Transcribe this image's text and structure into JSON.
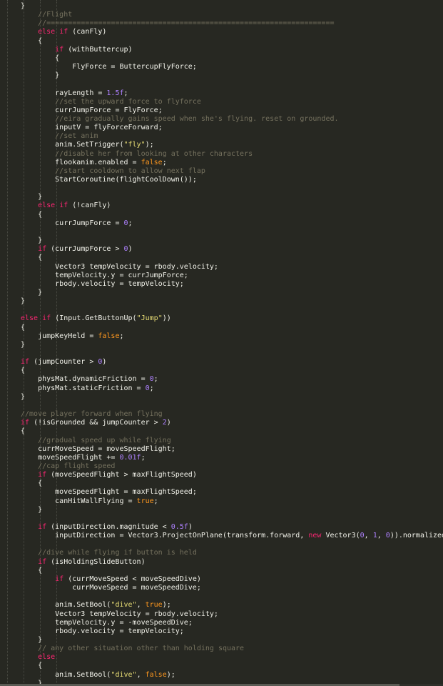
{
  "editor": {
    "language": "C#",
    "theme_colors": {
      "background": "#272822",
      "keyword": "#f92672",
      "comment": "#75715e",
      "string": "#e6db74",
      "number": "#ae81ff",
      "boolean": "#fd971f",
      "text": "#e8e8e2"
    },
    "lines": [
      {
        "col": 0,
        "tokens": [
          [
            "t",
            "}"
          ]
        ]
      },
      {
        "col": 4,
        "tokens": [
          [
            "c",
            "//Flight"
          ]
        ]
      },
      {
        "col": 4,
        "tokens": [
          [
            "c",
            "//==================================================================="
          ]
        ]
      },
      {
        "col": 4,
        "tokens": [
          [
            "k",
            "else"
          ],
          [
            "t",
            " "
          ],
          [
            "k",
            "if"
          ],
          [
            "t",
            " (canFly)"
          ]
        ]
      },
      {
        "col": 4,
        "tokens": [
          [
            "t",
            "{"
          ]
        ]
      },
      {
        "col": 8,
        "tokens": [
          [
            "k",
            "if"
          ],
          [
            "t",
            " (withButtercup)"
          ]
        ]
      },
      {
        "col": 8,
        "tokens": [
          [
            "t",
            "{"
          ]
        ]
      },
      {
        "col": 12,
        "tokens": [
          [
            "t",
            "FlyForce = ButtercupFlyForce;"
          ]
        ]
      },
      {
        "col": 8,
        "tokens": [
          [
            "t",
            "}"
          ]
        ]
      },
      {
        "col": 0,
        "tokens": []
      },
      {
        "col": 8,
        "tokens": [
          [
            "t",
            "rayLength = "
          ],
          [
            "n",
            "1.5f"
          ],
          [
            "t",
            ";"
          ]
        ]
      },
      {
        "col": 8,
        "tokens": [
          [
            "c",
            "//set the upward force to flyforce"
          ]
        ]
      },
      {
        "col": 8,
        "tokens": [
          [
            "t",
            "currJumpForce = FlyForce;"
          ]
        ]
      },
      {
        "col": 8,
        "tokens": [
          [
            "c",
            "//eira gradually gains speed when she's flying. reset on grounded."
          ]
        ]
      },
      {
        "col": 8,
        "tokens": [
          [
            "t",
            "inputV = flyForceForward;"
          ]
        ]
      },
      {
        "col": 8,
        "tokens": [
          [
            "c",
            "//set anim"
          ]
        ]
      },
      {
        "col": 8,
        "tokens": [
          [
            "t",
            "anim.SetTrigger("
          ],
          [
            "s",
            "\"fly\""
          ],
          [
            "t",
            ");"
          ]
        ]
      },
      {
        "col": 8,
        "tokens": [
          [
            "c",
            "//disable her from looking at other characters"
          ]
        ]
      },
      {
        "col": 8,
        "tokens": [
          [
            "t",
            "flookanim.enabled = "
          ],
          [
            "b",
            "false"
          ],
          [
            "t",
            ";"
          ]
        ]
      },
      {
        "col": 8,
        "tokens": [
          [
            "c",
            "//start cooldown to allow next flap"
          ]
        ]
      },
      {
        "col": 8,
        "tokens": [
          [
            "t",
            "StartCoroutine(flightCoolDown());"
          ]
        ]
      },
      {
        "col": 0,
        "tokens": []
      },
      {
        "col": 4,
        "tokens": [
          [
            "t",
            "}"
          ]
        ]
      },
      {
        "col": 4,
        "tokens": [
          [
            "k",
            "else"
          ],
          [
            "t",
            " "
          ],
          [
            "k",
            "if"
          ],
          [
            "t",
            " (!canFly)"
          ]
        ]
      },
      {
        "col": 4,
        "tokens": [
          [
            "t",
            "{"
          ]
        ]
      },
      {
        "col": 8,
        "tokens": [
          [
            "t",
            "currJumpForce = "
          ],
          [
            "n",
            "0"
          ],
          [
            "t",
            ";"
          ]
        ]
      },
      {
        "col": 0,
        "tokens": []
      },
      {
        "col": 4,
        "tokens": [
          [
            "t",
            "}"
          ]
        ]
      },
      {
        "col": 4,
        "tokens": [
          [
            "k",
            "if"
          ],
          [
            "t",
            " (currJumpForce > "
          ],
          [
            "n",
            "0"
          ],
          [
            "t",
            ")"
          ]
        ]
      },
      {
        "col": 4,
        "tokens": [
          [
            "t",
            "{"
          ]
        ]
      },
      {
        "col": 8,
        "tokens": [
          [
            "t",
            "Vector3 tempVelocity = rbody.velocity;"
          ]
        ]
      },
      {
        "col": 8,
        "tokens": [
          [
            "t",
            "tempVelocity.y = currJumpForce;"
          ]
        ]
      },
      {
        "col": 8,
        "tokens": [
          [
            "t",
            "rbody.velocity = tempVelocity;"
          ]
        ]
      },
      {
        "col": 4,
        "tokens": [
          [
            "t",
            "}"
          ]
        ]
      },
      {
        "col": 0,
        "tokens": [
          [
            "t",
            "}"
          ]
        ]
      },
      {
        "col": 0,
        "tokens": []
      },
      {
        "col": 0,
        "tokens": [
          [
            "k",
            "else"
          ],
          [
            "t",
            " "
          ],
          [
            "k",
            "if"
          ],
          [
            "t",
            " (Input.GetButtonUp("
          ],
          [
            "s",
            "\"Jump\""
          ],
          [
            "t",
            "))"
          ]
        ]
      },
      {
        "col": 0,
        "tokens": [
          [
            "t",
            "{"
          ]
        ]
      },
      {
        "col": 4,
        "tokens": [
          [
            "t",
            "jumpKeyHeld = "
          ],
          [
            "b",
            "false"
          ],
          [
            "t",
            ";"
          ]
        ]
      },
      {
        "col": 0,
        "tokens": [
          [
            "t",
            "}"
          ]
        ]
      },
      {
        "col": 0,
        "tokens": []
      },
      {
        "col": 0,
        "tokens": [
          [
            "k",
            "if"
          ],
          [
            "t",
            " (jumpCounter > "
          ],
          [
            "n",
            "0"
          ],
          [
            "t",
            ")"
          ]
        ]
      },
      {
        "col": 0,
        "tokens": [
          [
            "t",
            "{"
          ]
        ]
      },
      {
        "col": 4,
        "tokens": [
          [
            "t",
            "physMat.dynamicFriction = "
          ],
          [
            "n",
            "0"
          ],
          [
            "t",
            ";"
          ]
        ]
      },
      {
        "col": 4,
        "tokens": [
          [
            "t",
            "physMat.staticFriction = "
          ],
          [
            "n",
            "0"
          ],
          [
            "t",
            ";"
          ]
        ]
      },
      {
        "col": 0,
        "tokens": [
          [
            "t",
            "}"
          ]
        ]
      },
      {
        "col": 0,
        "tokens": []
      },
      {
        "col": 0,
        "tokens": [
          [
            "c",
            "//move player forward when flying"
          ]
        ]
      },
      {
        "col": 0,
        "tokens": [
          [
            "k",
            "if"
          ],
          [
            "t",
            " (!isGrounded && jumpCounter > "
          ],
          [
            "n",
            "2"
          ],
          [
            "t",
            ")"
          ]
        ]
      },
      {
        "col": 0,
        "tokens": [
          [
            "t",
            "{"
          ]
        ]
      },
      {
        "col": 4,
        "tokens": [
          [
            "c",
            "//gradual speed up while flying"
          ]
        ]
      },
      {
        "col": 4,
        "tokens": [
          [
            "t",
            "currMoveSpeed = moveSpeedFlight;"
          ]
        ]
      },
      {
        "col": 4,
        "tokens": [
          [
            "t",
            "moveSpeedFlight += "
          ],
          [
            "n",
            "0.01f"
          ],
          [
            "t",
            ";"
          ]
        ]
      },
      {
        "col": 4,
        "tokens": [
          [
            "c",
            "//cap flight speed"
          ]
        ]
      },
      {
        "col": 4,
        "tokens": [
          [
            "k",
            "if"
          ],
          [
            "t",
            " (moveSpeedFlight > maxFlightSpeed)"
          ]
        ]
      },
      {
        "col": 4,
        "tokens": [
          [
            "t",
            "{"
          ]
        ]
      },
      {
        "col": 8,
        "tokens": [
          [
            "t",
            "moveSpeedFlight = maxFlightSpeed;"
          ]
        ]
      },
      {
        "col": 8,
        "tokens": [
          [
            "t",
            "canHitWallFlying = "
          ],
          [
            "b",
            "true"
          ],
          [
            "t",
            ";"
          ]
        ]
      },
      {
        "col": 4,
        "tokens": [
          [
            "t",
            "}"
          ]
        ]
      },
      {
        "col": 0,
        "tokens": []
      },
      {
        "col": 4,
        "tokens": [
          [
            "k",
            "if"
          ],
          [
            "t",
            " (inputDirection.magnitude < "
          ],
          [
            "n",
            "0.5f"
          ],
          [
            "t",
            ")"
          ]
        ]
      },
      {
        "col": 8,
        "tokens": [
          [
            "t",
            "inputDirection = Vector3.ProjectOnPlane(transform.forward, "
          ],
          [
            "k",
            "new"
          ],
          [
            "t",
            " Vector3("
          ],
          [
            "n",
            "0"
          ],
          [
            "t",
            ", "
          ],
          [
            "n",
            "1"
          ],
          [
            "t",
            ", "
          ],
          [
            "n",
            "0"
          ],
          [
            "t",
            ")).normalized;"
          ]
        ]
      },
      {
        "col": 0,
        "tokens": []
      },
      {
        "col": 4,
        "tokens": [
          [
            "c",
            "//dive while flying if button is held"
          ]
        ]
      },
      {
        "col": 4,
        "tokens": [
          [
            "k",
            "if"
          ],
          [
            "t",
            " (isHoldingSlideButton)"
          ]
        ]
      },
      {
        "col": 4,
        "tokens": [
          [
            "t",
            "{"
          ]
        ]
      },
      {
        "col": 8,
        "tokens": [
          [
            "k",
            "if"
          ],
          [
            "t",
            " (currMoveSpeed < moveSpeedDive)"
          ]
        ]
      },
      {
        "col": 12,
        "tokens": [
          [
            "t",
            "currMoveSpeed = moveSpeedDive;"
          ]
        ]
      },
      {
        "col": 0,
        "tokens": []
      },
      {
        "col": 8,
        "tokens": [
          [
            "t",
            "anim.SetBool("
          ],
          [
            "s",
            "\"dive\""
          ],
          [
            "t",
            ", "
          ],
          [
            "b",
            "true"
          ],
          [
            "t",
            ");"
          ]
        ]
      },
      {
        "col": 8,
        "tokens": [
          [
            "t",
            "Vector3 tempVelocity = rbody.velocity;"
          ]
        ]
      },
      {
        "col": 8,
        "tokens": [
          [
            "t",
            "tempVelocity.y = -moveSpeedDive;"
          ]
        ]
      },
      {
        "col": 8,
        "tokens": [
          [
            "t",
            "rbody.velocity = tempVelocity;"
          ]
        ]
      },
      {
        "col": 4,
        "tokens": [
          [
            "t",
            "}"
          ]
        ]
      },
      {
        "col": 4,
        "tokens": [
          [
            "c",
            "// any other situation other than holding square"
          ]
        ]
      },
      {
        "col": 4,
        "tokens": [
          [
            "k",
            "else"
          ]
        ]
      },
      {
        "col": 4,
        "tokens": [
          [
            "t",
            "{"
          ]
        ]
      },
      {
        "col": 8,
        "tokens": [
          [
            "t",
            "anim.SetBool("
          ],
          [
            "s",
            "\"dive\""
          ],
          [
            "t",
            ", "
          ],
          [
            "b",
            "false"
          ],
          [
            "t",
            ");"
          ]
        ]
      },
      {
        "col": 4,
        "tokens": [
          [
            "t",
            "}"
          ]
        ]
      },
      {
        "col": 0,
        "tokens": [
          [
            "t",
            "}"
          ]
        ]
      }
    ]
  }
}
